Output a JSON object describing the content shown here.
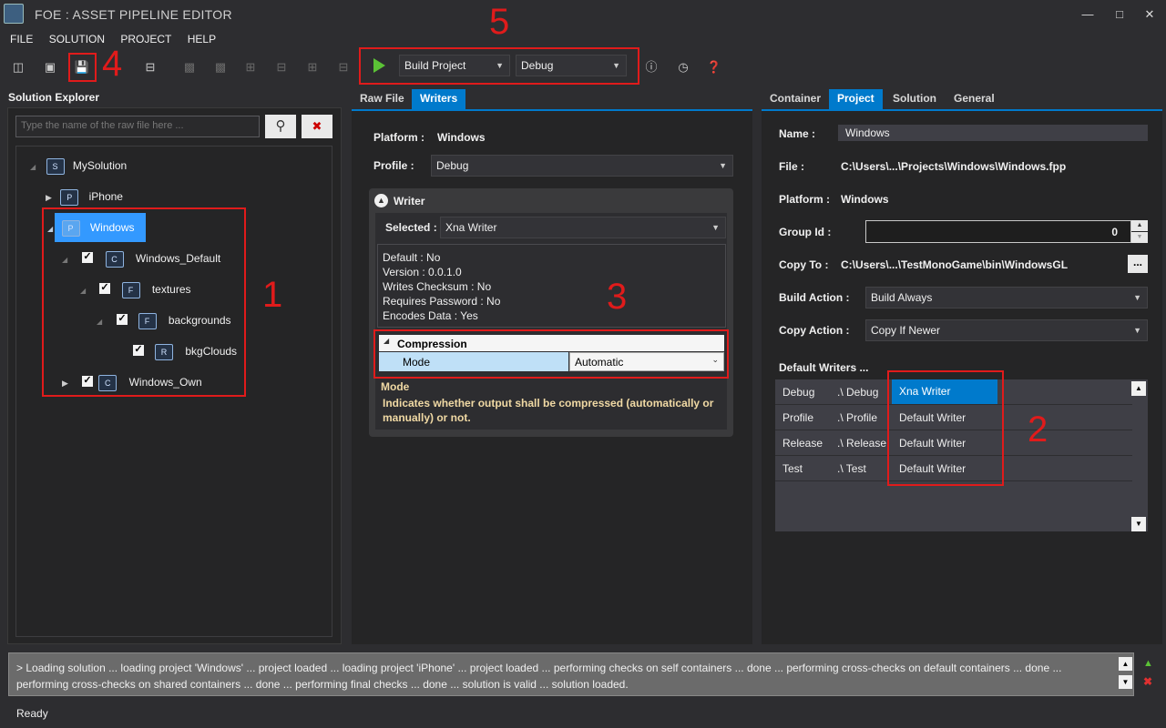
{
  "window": {
    "title": "FOE :  ASSET PIPELINE EDITOR",
    "minimize_icon": "minimize-icon",
    "maximize_icon": "maximize-icon",
    "close_icon": "close-icon"
  },
  "menu": [
    "FILE",
    "SOLUTION",
    "PROJECT",
    "HELP"
  ],
  "toolbar": {
    "build_action": "Build Project",
    "configuration": "Debug"
  },
  "annotations": {
    "n1": "1",
    "n2": "2",
    "n3": "3",
    "n4": "4",
    "n5": "5"
  },
  "solution_explorer": {
    "title": "Solution Explorer",
    "search_placeholder": "Type the name of the raw file here ...",
    "tree": {
      "solution": "MySolution",
      "iphone": "iPhone",
      "windows": "Windows",
      "windows_default": "Windows_Default",
      "textures": "textures",
      "backgrounds": "backgrounds",
      "bkgclouds": "bkgClouds",
      "windows_own": "Windows_Own"
    },
    "icon_letters": {
      "s": "S",
      "p": "P",
      "c": "C",
      "f": "F",
      "r": "R"
    }
  },
  "center": {
    "tabs": [
      "Raw File",
      "Writers"
    ],
    "platform_label": "Platform :",
    "platform_value": "Windows",
    "profile_label": "Profile :",
    "profile_value": "Debug",
    "writer_header": "Writer",
    "selected_label": "Selected :",
    "selected_value": "Xna Writer",
    "props": [
      "Default :  No",
      "Version :  0.0.1.0",
      "Writes Checksum :  No",
      "Requires Password :  No",
      "Encodes Data :  Yes"
    ],
    "compression_label": "Compression",
    "mode_label": "Mode",
    "mode_value": "Automatic",
    "desc_title": "Mode",
    "desc_text": "Indicates whether output shall be compressed (automatically or manually) or not."
  },
  "right": {
    "tabs": [
      "Container",
      "Project",
      "Solution",
      "General"
    ],
    "name_label": "Name :",
    "name_value": "Windows",
    "file_label": "File :",
    "file_value": "C:\\Users\\...\\Projects\\Windows\\Windows.fpp",
    "platform_label": "Platform :",
    "platform_value": "Windows",
    "group_label": "Group Id :",
    "group_value": "0",
    "copyto_label": "Copy To :",
    "copyto_value": "C:\\Users\\...\\TestMonoGame\\bin\\WindowsGL",
    "browse_label": "...",
    "build_action_label": "Build Action :",
    "build_action_value": "Build Always",
    "copy_action_label": "Copy Action :",
    "copy_action_value": "Copy If Newer",
    "default_writers_label": "Default Writers ...",
    "writers": [
      {
        "profile": "Debug",
        "path": ".\\ Debug",
        "writer": "Xna Writer"
      },
      {
        "profile": "Profile",
        "path": ".\\ Profile",
        "writer": "Default Writer"
      },
      {
        "profile": "Release",
        "path": ".\\ Release",
        "writer": "Default Writer"
      },
      {
        "profile": "Test",
        "path": ".\\ Test",
        "writer": "Default Writer"
      }
    ]
  },
  "log": {
    "text": "> Loading solution ... loading project 'Windows' ... project loaded ... loading project 'iPhone' ... project loaded ... performing checks on self containers ... done ... performing cross-checks on default containers ... done ... performing cross-checks on shared containers ... done ... performing final checks ... done ... solution is valid ... solution loaded."
  },
  "status": {
    "text": "Ready"
  }
}
